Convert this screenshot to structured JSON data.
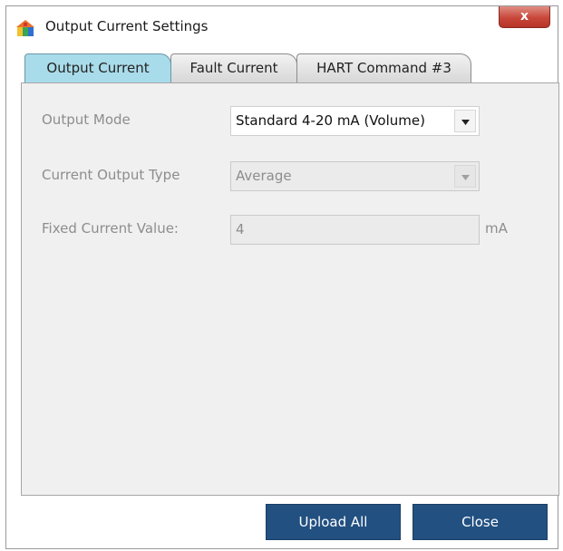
{
  "window": {
    "title": "Output Current Settings",
    "close_glyph": "x"
  },
  "tabs": [
    {
      "label": "Output Current",
      "active": true
    },
    {
      "label": "Fault Current",
      "active": false
    },
    {
      "label": "HART Command #3",
      "active": false
    }
  ],
  "form": {
    "output_mode": {
      "label": "Output Mode",
      "value": "Standard 4-20 mA (Volume)"
    },
    "current_output_type": {
      "label": "Current Output Type",
      "value": "Average"
    },
    "fixed_current": {
      "label": "Fixed Current Value:",
      "value": "4",
      "unit": "mA"
    }
  },
  "buttons": {
    "upload_all": "Upload All",
    "close": "Close"
  },
  "colors": {
    "active_tab": "#a9dcea",
    "button_bg": "#225081",
    "panel_bg": "#f0f0f0",
    "close_button": "#c9473a"
  },
  "icons": {
    "app": "colorful-house-icon",
    "dropdown": "triangle-down-icon"
  }
}
